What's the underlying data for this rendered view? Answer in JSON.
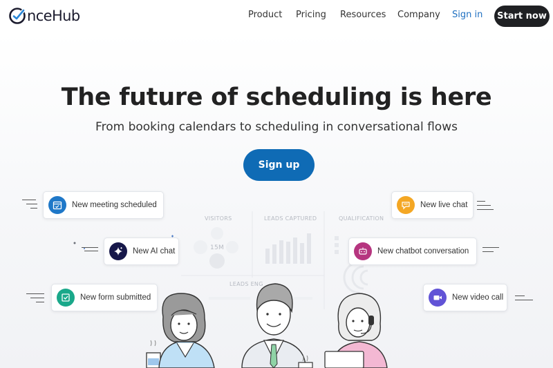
{
  "brand": {
    "logo_text": "nceHub",
    "logo_letter": "O"
  },
  "nav": {
    "links": [
      {
        "label": "Product"
      },
      {
        "label": "Pricing"
      },
      {
        "label": "Resources"
      },
      {
        "label": "Company"
      },
      {
        "label": "Sign in"
      }
    ],
    "cta": "Start now"
  },
  "hero": {
    "title": "The future of scheduling is here",
    "subtitle": "From booking calendars to scheduling in conversational flows",
    "signup_label": "Sign up"
  },
  "dashboard": {
    "labels": [
      "VISITORS",
      "LEADS CAPTURED",
      "QUALIFICATION",
      "LEADS ENG",
      "15M"
    ]
  },
  "notifications": [
    {
      "label": "New meeting scheduled",
      "icon": "calendar-icon",
      "color": "#1f78c8"
    },
    {
      "label": "New AI chat",
      "icon": "sparkle-icon",
      "color": "#17184a"
    },
    {
      "label": "New form submitted",
      "icon": "form-check-icon",
      "color": "#1aa88a"
    },
    {
      "label": "New live chat",
      "icon": "chat-bubble-icon",
      "color": "#f4a724"
    },
    {
      "label": "New chatbot conversation",
      "icon": "chatbot-icon",
      "color": "#b6357f"
    },
    {
      "label": "New video call",
      "icon": "video-camera-icon",
      "color": "#6153d6"
    }
  ],
  "colors": {
    "primary": "#0f6bb5",
    "dark_button": "#1f2023",
    "link": "#1f70c1"
  }
}
